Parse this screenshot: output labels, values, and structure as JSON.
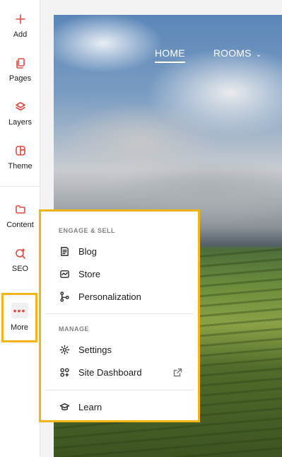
{
  "sidebar": {
    "items": [
      {
        "label": "Add",
        "icon": "plus-icon"
      },
      {
        "label": "Pages",
        "icon": "pages-icon"
      },
      {
        "label": "Layers",
        "icon": "layers-icon"
      },
      {
        "label": "Theme",
        "icon": "theme-icon"
      },
      {
        "label": "Content",
        "icon": "folder-icon"
      },
      {
        "label": "SEO",
        "icon": "seo-icon"
      }
    ],
    "more": {
      "label": "More",
      "icon": "ellipsis-icon",
      "glyph": "•••"
    }
  },
  "site": {
    "nav": {
      "home": "HOME",
      "rooms": "ROOMS"
    }
  },
  "menu": {
    "engage_title": "ENGAGE & SELL",
    "engage_items": [
      {
        "label": "Blog",
        "icon": "blog-icon"
      },
      {
        "label": "Store",
        "icon": "store-icon"
      },
      {
        "label": "Personalization",
        "icon": "personalization-icon"
      }
    ],
    "manage_title": "MANAGE",
    "manage_items": [
      {
        "label": "Settings",
        "icon": "gear-icon"
      },
      {
        "label": "Site Dashboard",
        "icon": "dashboard-icon",
        "external": true
      }
    ],
    "learn": {
      "label": "Learn",
      "icon": "graduation-cap-icon"
    }
  },
  "colors": {
    "accent": "#e1493f",
    "highlight": "#f2b417"
  }
}
